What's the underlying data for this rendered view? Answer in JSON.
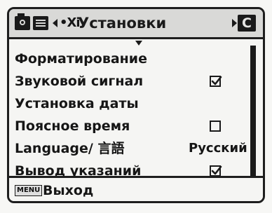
{
  "header": {
    "setup_icon_text": "•Xi",
    "title": "Установки",
    "right_tab_label": "C",
    "icons": [
      "camera-tab-icon",
      "playback-tab-icon",
      "setup-tab-icon"
    ]
  },
  "menu": {
    "items": [
      {
        "label": "Форматирование",
        "value": ""
      },
      {
        "label": "Звуковой сигнал",
        "checked": true
      },
      {
        "label": "Установка даты",
        "value": ""
      },
      {
        "label": "Поясное время",
        "checked": false
      },
      {
        "label": "Language/ 言語",
        "value": "Русский"
      },
      {
        "label": "Вывод указаний",
        "checked": true
      }
    ]
  },
  "footer": {
    "key_label": "MENU",
    "action_label": "Выход"
  },
  "colors": {
    "background": "#f5f5f3",
    "header": "#d9d9d7",
    "ink": "#1a1a1a"
  }
}
